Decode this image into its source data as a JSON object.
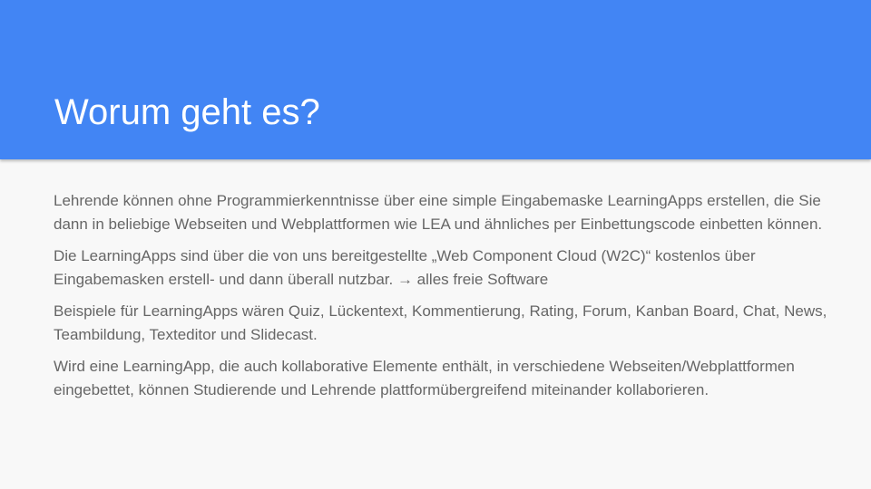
{
  "slide": {
    "title": "Worum geht es?",
    "paragraphs": [
      "Lehrende können ohne Programmierkenntnisse über eine simple Eingabemaske LearningApps erstellen, die Sie dann in beliebige Webseiten und Webplattformen wie LEA und ähnliches per Einbettungscode einbetten können.",
      "Die LearningApps sind über die von uns bereitgestellte „Web Component Cloud (W2C)“ kostenlos über Eingabemasken erstell- und dann überall nutzbar. → alles freie Software",
      "Beispiele für LearningApps wären Quiz, Lückentext, Kommentierung, Rating, Forum, Kanban Board, Chat, News, Teambildung, Texteditor und Slidecast.",
      "Wird eine LearningApp, die auch kollaborative Elemente enthält, in verschiedene Webseiten/Webplattformen eingebettet, können Studierende und Lehrende plattformübergreifend miteinander kollaborieren."
    ]
  },
  "colors": {
    "header_background": "#4285f4",
    "slide_background": "#f8f8f8",
    "title_text": "#ffffff",
    "body_text": "#666666"
  }
}
